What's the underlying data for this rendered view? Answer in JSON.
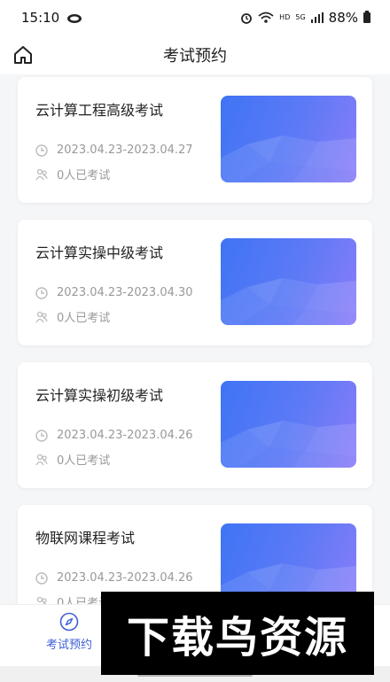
{
  "status_bar": {
    "time": "15:10",
    "network_label": "HD",
    "signal_label": "5G",
    "battery": "88%"
  },
  "header": {
    "title": "考试预约",
    "home_icon": "home-icon"
  },
  "exams": [
    {
      "title": "云计算工程高级考试",
      "date_range": "2023.04.23-2023.04.27",
      "count": "0人已考试"
    },
    {
      "title": "云计算实操中级考试",
      "date_range": "2023.04.23-2023.04.30",
      "count": "0人已考试"
    },
    {
      "title": "云计算实操初级考试",
      "date_range": "2023.04.23-2023.04.26",
      "count": "0人已考试"
    },
    {
      "title": "物联网课程考试",
      "date_range": "2023.04.23-2023.04.26",
      "count": "0人已考试"
    }
  ],
  "tabbar": {
    "active_tab": "考试预约",
    "active_color": "#3d5fd6"
  },
  "watermark": {
    "text": "下载鸟资源"
  },
  "colors": {
    "accent": "#3d5fd6",
    "thumb_start": "#3f74f4",
    "thumb_end": "#8a7cf8"
  }
}
